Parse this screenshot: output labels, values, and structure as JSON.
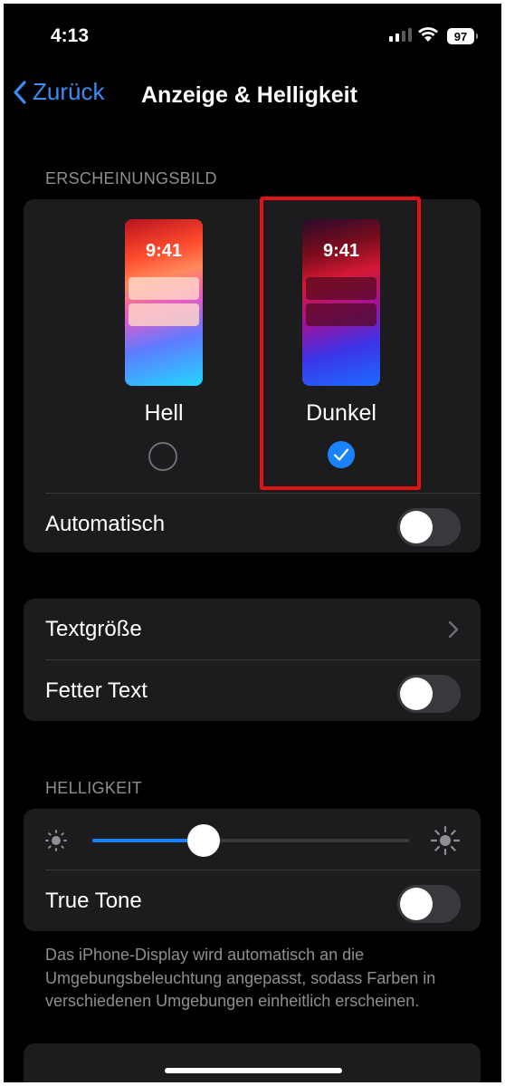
{
  "status_bar": {
    "time": "4:13",
    "battery": "97"
  },
  "nav": {
    "back_label": "Zurück",
    "title": "Anzeige & Helligkeit"
  },
  "appearance": {
    "header": "ERSCHEINUNGSBILD",
    "options": [
      {
        "label": "Hell",
        "preview_time": "9:41",
        "selected": false
      },
      {
        "label": "Dunkel",
        "preview_time": "9:41",
        "selected": true
      }
    ],
    "auto_label": "Automatisch",
    "auto_on": false
  },
  "text": {
    "size_label": "Textgröße",
    "bold_label": "Fetter Text",
    "bold_on": false
  },
  "brightness": {
    "header": "HELLIGKEIT",
    "level": 0.35,
    "true_tone_label": "True Tone",
    "true_tone_on": false,
    "footnote": "Das iPhone-Display wird automatisch an die Umgebungsbeleuchtung angepasst, sodass Farben in verschiedenen Umgebungen einheitlich erscheinen."
  },
  "colors": {
    "accent": "#1a82fb",
    "highlight": "#e01414",
    "background": "#000000",
    "group_background": "#1c1c1e"
  },
  "icons": [
    "chevron-left-icon",
    "chevron-right-icon",
    "checkmark-icon",
    "sun-small-icon",
    "sun-large-icon",
    "wifi-icon",
    "signal-icon",
    "battery-icon"
  ]
}
